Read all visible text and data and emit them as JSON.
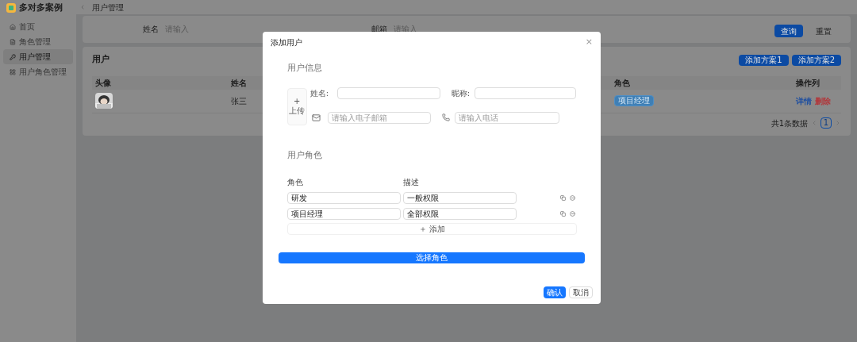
{
  "app": {
    "title": "多对多案例"
  },
  "sidebar": {
    "items": [
      {
        "label": "首页",
        "selected": false
      },
      {
        "label": "角色管理",
        "selected": false
      },
      {
        "label": "用户管理",
        "selected": true
      },
      {
        "label": "用户角色管理",
        "selected": false
      }
    ]
  },
  "breadcrumb": "用户管理",
  "search": {
    "fields": [
      {
        "label": "姓名",
        "placeholder": "请输入"
      },
      {
        "label": "邮箱",
        "placeholder": "请输入"
      }
    ],
    "buttons": [
      "查询",
      "重置"
    ]
  },
  "users": {
    "title": "用户",
    "buttons": [
      "添加方案1",
      "添加方案2"
    ],
    "columns": [
      "头像",
      "姓名",
      "角色",
      "操作列"
    ],
    "rows": [
      {
        "name": "张三",
        "roles": [
          "项目经理"
        ],
        "actions": [
          {
            "label": "详情",
            "color": "#1d4ea0"
          },
          {
            "label": "删除",
            "color": "#b2363a"
          }
        ]
      }
    ],
    "total": "共1条数据",
    "pages": [
      {
        "label": "1",
        "selected": true
      }
    ]
  },
  "dialog": {
    "title": "添加用户",
    "close": "×",
    "info_title": "用户信息",
    "upload": {
      "icon": "+",
      "label": "上传"
    },
    "name": {
      "label": "姓名:"
    },
    "nickname": {
      "label": "昵称:"
    },
    "email": {
      "placeholder": "请输入电子邮箱"
    },
    "phone": {
      "placeholder": "请输入电话"
    },
    "roles_title": "用户角色",
    "role_columns": [
      "角色",
      "描述"
    ],
    "roles": [
      {
        "role": "研发",
        "description": "一般权限"
      },
      {
        "role": "项目经理",
        "description": "全部权限"
      }
    ],
    "add": "添加",
    "choose": "选择角色",
    "ok": "确认",
    "cancel": "取消"
  }
}
